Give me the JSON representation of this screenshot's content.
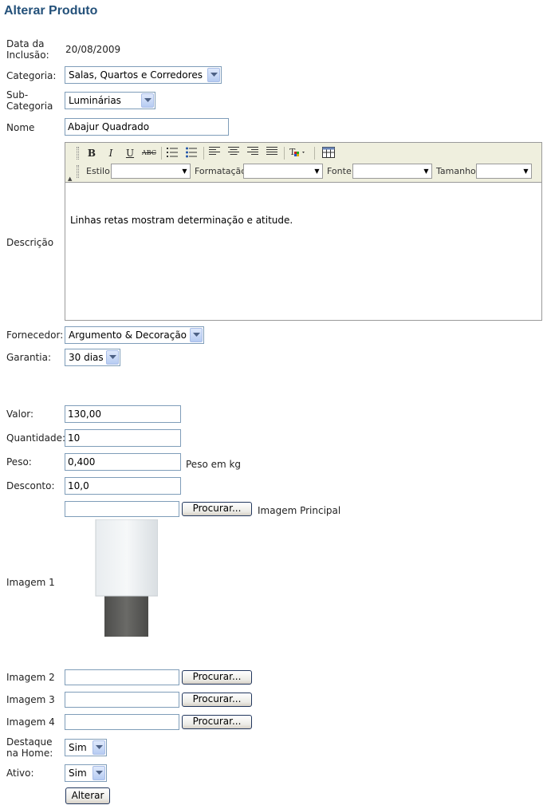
{
  "page": {
    "title": "Alterar Produto"
  },
  "labels": {
    "data_inclusao": "Data da Inclusão:",
    "categoria": "Categoria:",
    "sub_categoria": "Sub-Categoria",
    "nome": "Nome",
    "descricao": "Descrição",
    "fornecedor": "Fornecedor:",
    "garantia": "Garantia:",
    "valor": "Valor:",
    "quantidade": "Quantidade:",
    "peso": "Peso:",
    "desconto": "Desconto:",
    "imagem1": "Imagem 1",
    "imagem2": "Imagem 2",
    "imagem3": "Imagem 3",
    "imagem4": "Imagem 4",
    "destaque": "Destaque na Home:",
    "ativo": "Ativo:"
  },
  "values": {
    "data_inclusao": "20/08/2009",
    "categoria": "Salas, Quartos e Corredores",
    "sub_categoria": "Luminárias",
    "nome": "Abajur Quadrado",
    "fornecedor": "Argumento & Decoração",
    "garantia": "30 dias",
    "valor": "130,00",
    "quantidade": "10",
    "peso": "0,400",
    "peso_hint": "Peso em kg",
    "desconto": "10,0",
    "imagem_principal_hint": "Imagem Principal",
    "destaque": "Sim",
    "ativo": "Sim"
  },
  "editor": {
    "content": "Linhas retas mostram determinação e atitude.",
    "toolbar": {
      "bold": "B",
      "italic": "I",
      "underline": "U",
      "strike": "ABC",
      "estilo_label": "Estilo",
      "formatacao_label": "Formatação",
      "fonte_label": "Fonte",
      "tamanho_label": "Tamanho"
    }
  },
  "buttons": {
    "procurar": "Procurar...",
    "alterar": "Alterar"
  },
  "colors": {
    "title": "#24517a",
    "input_border": "#7f9db9",
    "toolbar_bg": "#efefde"
  }
}
